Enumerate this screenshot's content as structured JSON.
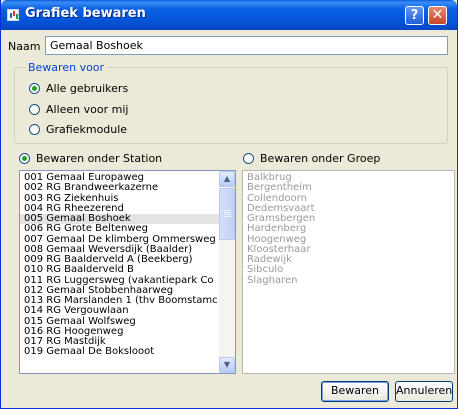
{
  "window": {
    "title": "Grafiek bewaren"
  },
  "titlebar": {
    "help_label": "?",
    "close_label": "✕"
  },
  "naam": {
    "label": "Naam",
    "value": "Gemaal Boshoek"
  },
  "bewaren_voor": {
    "title": "Bewaren voor",
    "options": [
      {
        "label": "Alle gebruikers",
        "checked": true
      },
      {
        "label": "Alleen voor mij",
        "checked": false
      },
      {
        "label": "Grafiekmodule",
        "checked": false
      }
    ]
  },
  "station": {
    "label": "Bewaren onder Station",
    "checked": true,
    "items": [
      "001 Gemaal Europaweg",
      "002 RG Brandweerkazerne",
      "003 RG Ziekenhuis",
      "004 RG Rheezerend",
      "005 Gemaal Boshoek",
      "006 RG Grote Beltenweg",
      "007 Gemaal De klimberg Ommersweg",
      "008 Gemaal Weversdijk (Baalder)",
      "009 RG Baalderveld A (Beekberg)",
      "010 RG Baalderveld B",
      "011 RG Luggersweg (vakantiepark Co",
      "012 Gemaal Stobbenhaarweg",
      "013 RG Marslanden 1 (thv Boomstamc",
      "014 RG Vergouwlaan",
      "015 Gemaal Wolfsweg",
      "016 RG Hoogenweg",
      "017 RG Mastdijk",
      "019 Gemaal De Bokslooot"
    ],
    "selected_index": 4
  },
  "groep": {
    "label": "Bewaren onder Groep",
    "checked": false,
    "items": [
      "Balkbrug",
      "Bergentheim",
      "Collendoorn",
      "Dedemsvaart",
      "Gramsbergen",
      "Hardenberg",
      "Hoogenweg",
      "Kloosterhaar",
      "Radewijk",
      "Sibculo",
      "Slagharen"
    ]
  },
  "buttons": {
    "save": "Bewaren",
    "cancel": "Annuleren"
  }
}
